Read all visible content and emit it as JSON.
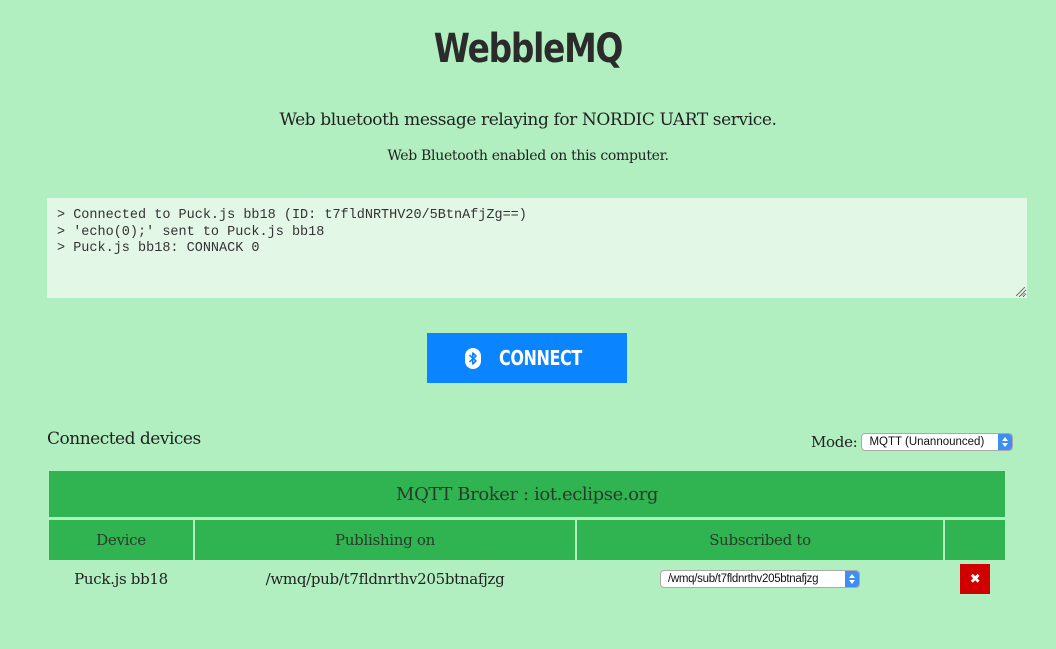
{
  "header": {
    "title": "WebbleMQ",
    "subtitle": "Web bluetooth message relaying for NORDIC UART service.",
    "status": "Web Bluetooth enabled on this computer."
  },
  "log": {
    "lines": [
      "> Connected to Puck.js bb18 (ID: t7fldNRTHV20/5BtnAfjZg==)",
      "> 'echo(0);' sent to Puck.js bb18",
      "> Puck.js bb18: CONNACK 0"
    ]
  },
  "connect": {
    "label": "CONNECT",
    "icon": "bluetooth-icon",
    "color": "#0b84ff"
  },
  "devices": {
    "heading": "Connected devices",
    "mode_label": "Mode:",
    "mode_value": "MQTT (Unannounced)",
    "broker": "MQTT Broker : iot.eclipse.org",
    "columns": [
      "Device",
      "Publishing on",
      "Subscribed to",
      ""
    ],
    "rows": [
      {
        "device": "Puck.js bb18",
        "publishing": "/wmq/pub/t7fldnrthv205btnafjzg",
        "subscribed": "/wmq/sub/t7fldnrthv205btnafjzg",
        "remove_icon": "close-icon"
      }
    ]
  },
  "colors": {
    "background": "#b1efc0",
    "table_header": "#30b351",
    "remove": "#d10000"
  }
}
